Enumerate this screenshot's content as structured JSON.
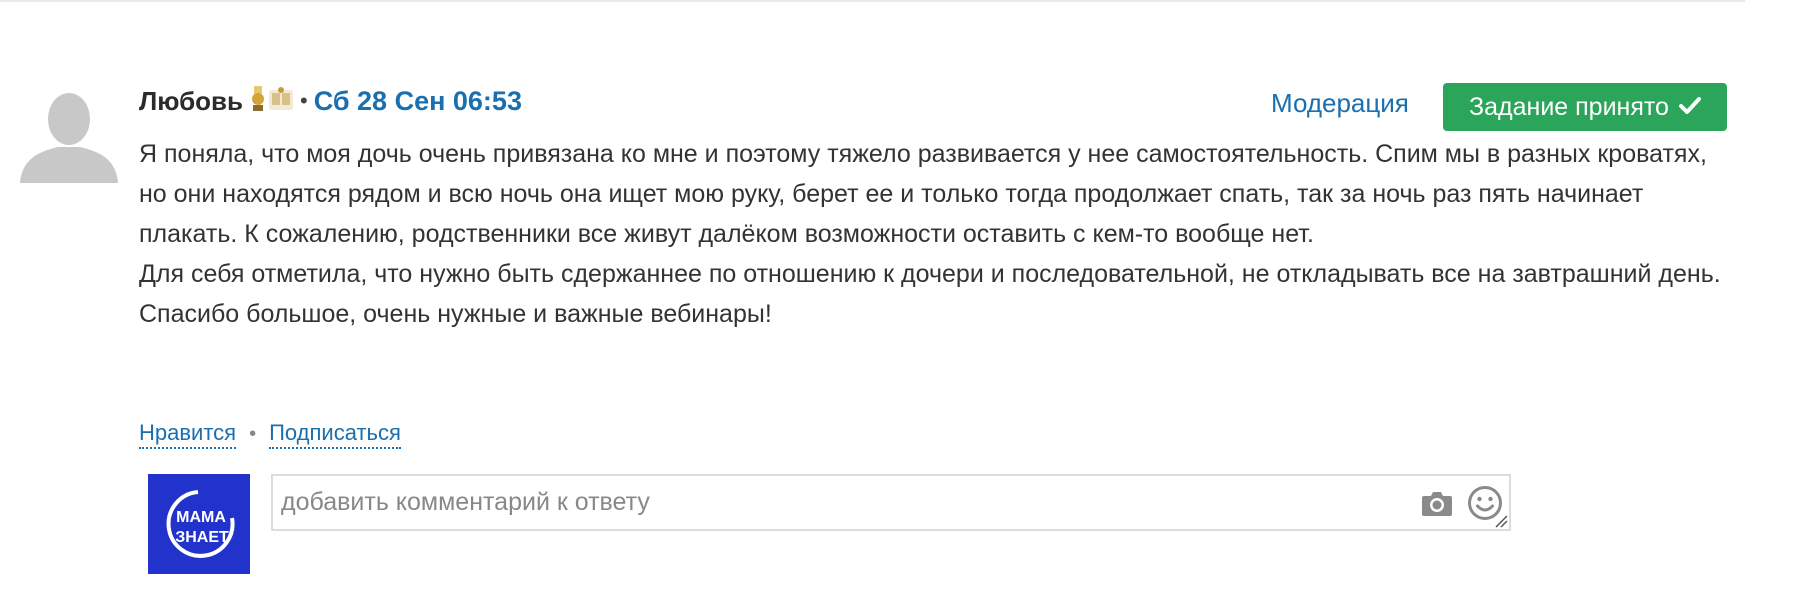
{
  "post": {
    "author": "Любовь",
    "separator": "•",
    "date": "Сб 28 Сен 06:53",
    "moderation_label": "Модерация",
    "accepted_label": "Задание принято",
    "paragraphs": [
      "Я поняла, что моя дочь очень привязана ко мне и поэтому тяжело развивается у нее самостоятельность. Спим мы в разных кроватях, но они находятся рядом и всю ночь она ищет мою руку, берет ее и только тогда продолжает спать, так за ночь раз пять начинает плакать. К сожалению, родственники все живут далёком возможности оставить с кем-то вообще нет.",
      "Для себя отметила, что нужно быть сдержаннее по отношению к дочери и последовательной, не откладывать все на завтрашний день. Спасибо большое, очень нужные и важные вебинары!"
    ]
  },
  "actions": {
    "like_label": "Нравится",
    "dot": "•",
    "subscribe_label": "Подписаться"
  },
  "logo": {
    "line1": "МАМА",
    "line2": "ЗНАЕТ"
  },
  "comment": {
    "placeholder": "добавить комментарий к ответу"
  },
  "colors": {
    "link": "#1a6faf",
    "accepted_bg": "#2aa55a",
    "logo_bg": "#2233cc"
  },
  "icons": [
    "user-avatar-icon",
    "medal-badge-icon",
    "book-badge-icon",
    "check-icon",
    "camera-icon",
    "smile-icon",
    "resize-handle-icon"
  ]
}
